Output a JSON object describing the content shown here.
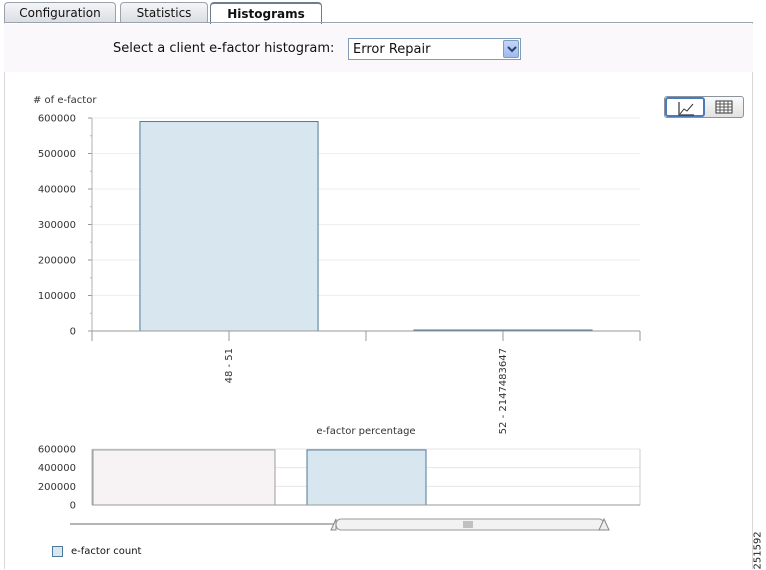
{
  "tabs": [
    {
      "label": "Configuration",
      "active": false
    },
    {
      "label": "Statistics",
      "active": false
    },
    {
      "label": "Histograms",
      "active": true
    }
  ],
  "selector": {
    "label": "Select a client e-factor histogram:",
    "value": "Error Repair"
  },
  "view_toggle": {
    "chart_icon": "line-chart-icon",
    "table_icon": "table-icon",
    "active": "chart"
  },
  "legend": {
    "label": "e-factor count"
  },
  "side_code": "251592",
  "colors": {
    "bar_fill": "#d8e6f0",
    "bar_stroke": "#4d7a99",
    "navigator_selection": "#f7f2f4"
  },
  "chart_data": [
    {
      "type": "bar",
      "ylabel": "# of e-factor",
      "xlabel": "",
      "categories": [
        "48 - 51",
        "52 - 2147483647"
      ],
      "values": [
        590000,
        1000
      ],
      "ylim": [
        0,
        600000
      ],
      "yticks": [
        0,
        100000,
        200000,
        300000,
        400000,
        500000,
        600000
      ],
      "ytick_labels": [
        "0",
        "100000",
        "200000",
        "300000",
        "400000",
        "500000",
        "600000"
      ],
      "grid": true
    },
    {
      "type": "bar",
      "title": "e-factor percentage",
      "role": "overview navigator",
      "values": [
        590000,
        590000
      ],
      "ylim": [
        0,
        600000
      ],
      "yticks": [
        0,
        200000,
        400000,
        600000
      ],
      "ytick_labels": [
        "0",
        "200000",
        "400000",
        "600000"
      ],
      "selection_range": [
        0.5,
        1.0
      ]
    }
  ]
}
